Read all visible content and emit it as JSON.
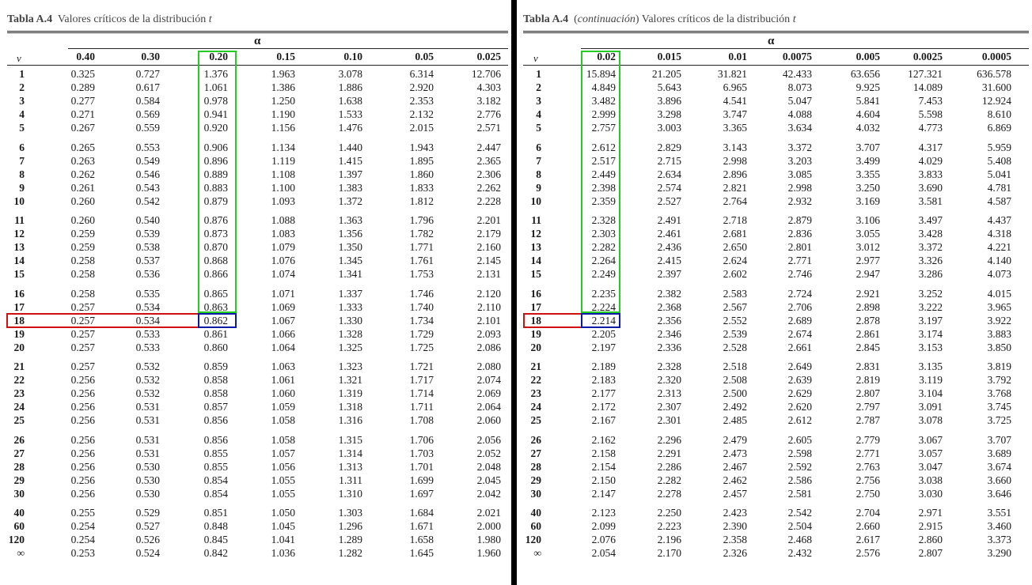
{
  "left": {
    "caption_bold": "Tabla A.4",
    "caption_text": "Valores críticos de la distribución",
    "caption_var": "t",
    "alpha_symbol": "α",
    "nu_symbol": "v",
    "columns": [
      "0.40",
      "0.30",
      "0.20",
      "0.15",
      "0.10",
      "0.05",
      "0.025"
    ],
    "rows": [
      {
        "nu": "1",
        "v": [
          "0.325",
          "0.727",
          "1.376",
          "1.963",
          "3.078",
          "6.314",
          "12.706"
        ]
      },
      {
        "nu": "2",
        "v": [
          "0.289",
          "0.617",
          "1.061",
          "1.386",
          "1.886",
          "2.920",
          "4.303"
        ]
      },
      {
        "nu": "3",
        "v": [
          "0.277",
          "0.584",
          "0.978",
          "1.250",
          "1.638",
          "2.353",
          "3.182"
        ]
      },
      {
        "nu": "4",
        "v": [
          "0.271",
          "0.569",
          "0.941",
          "1.190",
          "1.533",
          "2.132",
          "2.776"
        ]
      },
      {
        "nu": "5",
        "v": [
          "0.267",
          "0.559",
          "0.920",
          "1.156",
          "1.476",
          "2.015",
          "2.571"
        ]
      },
      {
        "nu": "6",
        "v": [
          "0.265",
          "0.553",
          "0.906",
          "1.134",
          "1.440",
          "1.943",
          "2.447"
        ]
      },
      {
        "nu": "7",
        "v": [
          "0.263",
          "0.549",
          "0.896",
          "1.119",
          "1.415",
          "1.895",
          "2.365"
        ]
      },
      {
        "nu": "8",
        "v": [
          "0.262",
          "0.546",
          "0.889",
          "1.108",
          "1.397",
          "1.860",
          "2.306"
        ]
      },
      {
        "nu": "9",
        "v": [
          "0.261",
          "0.543",
          "0.883",
          "1.100",
          "1.383",
          "1.833",
          "2.262"
        ]
      },
      {
        "nu": "10",
        "v": [
          "0.260",
          "0.542",
          "0.879",
          "1.093",
          "1.372",
          "1.812",
          "2.228"
        ]
      },
      {
        "nu": "11",
        "v": [
          "0.260",
          "0.540",
          "0.876",
          "1.088",
          "1.363",
          "1.796",
          "2.201"
        ]
      },
      {
        "nu": "12",
        "v": [
          "0.259",
          "0.539",
          "0.873",
          "1.083",
          "1.356",
          "1.782",
          "2.179"
        ]
      },
      {
        "nu": "13",
        "v": [
          "0.259",
          "0.538",
          "0.870",
          "1.079",
          "1.350",
          "1.771",
          "2.160"
        ]
      },
      {
        "nu": "14",
        "v": [
          "0.258",
          "0.537",
          "0.868",
          "1.076",
          "1.345",
          "1.761",
          "2.145"
        ]
      },
      {
        "nu": "15",
        "v": [
          "0.258",
          "0.536",
          "0.866",
          "1.074",
          "1.341",
          "1.753",
          "2.131"
        ]
      },
      {
        "nu": "16",
        "v": [
          "0.258",
          "0.535",
          "0.865",
          "1.071",
          "1.337",
          "1.746",
          "2.120"
        ]
      },
      {
        "nu": "17",
        "v": [
          "0.257",
          "0.534",
          "0.863",
          "1.069",
          "1.333",
          "1.740",
          "2.110"
        ]
      },
      {
        "nu": "18",
        "v": [
          "0.257",
          "0.534",
          "0.862",
          "1.067",
          "1.330",
          "1.734",
          "2.101"
        ]
      },
      {
        "nu": "19",
        "v": [
          "0.257",
          "0.533",
          "0.861",
          "1.066",
          "1.328",
          "1.729",
          "2.093"
        ]
      },
      {
        "nu": "20",
        "v": [
          "0.257",
          "0.533",
          "0.860",
          "1.064",
          "1.325",
          "1.725",
          "2.086"
        ]
      },
      {
        "nu": "21",
        "v": [
          "0.257",
          "0.532",
          "0.859",
          "1.063",
          "1.323",
          "1.721",
          "2.080"
        ]
      },
      {
        "nu": "22",
        "v": [
          "0.256",
          "0.532",
          "0.858",
          "1.061",
          "1.321",
          "1.717",
          "2.074"
        ]
      },
      {
        "nu": "23",
        "v": [
          "0.256",
          "0.532",
          "0.858",
          "1.060",
          "1.319",
          "1.714",
          "2.069"
        ]
      },
      {
        "nu": "24",
        "v": [
          "0.256",
          "0.531",
          "0.857",
          "1.059",
          "1.318",
          "1.711",
          "2.064"
        ]
      },
      {
        "nu": "25",
        "v": [
          "0.256",
          "0.531",
          "0.856",
          "1.058",
          "1.316",
          "1.708",
          "2.060"
        ]
      },
      {
        "nu": "26",
        "v": [
          "0.256",
          "0.531",
          "0.856",
          "1.058",
          "1.315",
          "1.706",
          "2.056"
        ]
      },
      {
        "nu": "27",
        "v": [
          "0.256",
          "0.531",
          "0.855",
          "1.057",
          "1.314",
          "1.703",
          "2.052"
        ]
      },
      {
        "nu": "28",
        "v": [
          "0.256",
          "0.530",
          "0.855",
          "1.056",
          "1.313",
          "1.701",
          "2.048"
        ]
      },
      {
        "nu": "29",
        "v": [
          "0.256",
          "0.530",
          "0.854",
          "1.055",
          "1.311",
          "1.699",
          "2.045"
        ]
      },
      {
        "nu": "30",
        "v": [
          "0.256",
          "0.530",
          "0.854",
          "1.055",
          "1.310",
          "1.697",
          "2.042"
        ]
      },
      {
        "nu": "40",
        "v": [
          "0.255",
          "0.529",
          "0.851",
          "1.050",
          "1.303",
          "1.684",
          "2.021"
        ]
      },
      {
        "nu": "60",
        "v": [
          "0.254",
          "0.527",
          "0.848",
          "1.045",
          "1.296",
          "1.671",
          "2.000"
        ]
      },
      {
        "nu": "120",
        "v": [
          "0.254",
          "0.526",
          "0.845",
          "1.041",
          "1.289",
          "1.658",
          "1.980"
        ]
      },
      {
        "nu": "∞",
        "v": [
          "0.253",
          "0.524",
          "0.842",
          "1.036",
          "1.282",
          "1.645",
          "1.960"
        ]
      }
    ]
  },
  "right": {
    "caption_bold": "Tabla A.4",
    "caption_paren_open": "(",
    "caption_cont": "continuación",
    "caption_paren_close": ")",
    "caption_text": "Valores críticos de la distribución",
    "caption_var": "t",
    "alpha_symbol": "α",
    "nu_symbol": "v",
    "columns": [
      "0.02",
      "0.015",
      "0.01",
      "0.0075",
      "0.005",
      "0.0025",
      "0.0005"
    ],
    "rows": [
      {
        "nu": "1",
        "v": [
          "15.894",
          "21.205",
          "31.821",
          "42.433",
          "63.656",
          "127.321",
          "636.578"
        ]
      },
      {
        "nu": "2",
        "v": [
          "4.849",
          "5.643",
          "6.965",
          "8.073",
          "9.925",
          "14.089",
          "31.600"
        ]
      },
      {
        "nu": "3",
        "v": [
          "3.482",
          "3.896",
          "4.541",
          "5.047",
          "5.841",
          "7.453",
          "12.924"
        ]
      },
      {
        "nu": "4",
        "v": [
          "2.999",
          "3.298",
          "3.747",
          "4.088",
          "4.604",
          "5.598",
          "8.610"
        ]
      },
      {
        "nu": "5",
        "v": [
          "2.757",
          "3.003",
          "3.365",
          "3.634",
          "4.032",
          "4.773",
          "6.869"
        ]
      },
      {
        "nu": "6",
        "v": [
          "2.612",
          "2.829",
          "3.143",
          "3.372",
          "3.707",
          "4.317",
          "5.959"
        ]
      },
      {
        "nu": "7",
        "v": [
          "2.517",
          "2.715",
          "2.998",
          "3.203",
          "3.499",
          "4.029",
          "5.408"
        ]
      },
      {
        "nu": "8",
        "v": [
          "2.449",
          "2.634",
          "2.896",
          "3.085",
          "3.355",
          "3.833",
          "5.041"
        ]
      },
      {
        "nu": "9",
        "v": [
          "2.398",
          "2.574",
          "2.821",
          "2.998",
          "3.250",
          "3.690",
          "4.781"
        ]
      },
      {
        "nu": "10",
        "v": [
          "2.359",
          "2.527",
          "2.764",
          "2.932",
          "3.169",
          "3.581",
          "4.587"
        ]
      },
      {
        "nu": "11",
        "v": [
          "2.328",
          "2.491",
          "2.718",
          "2.879",
          "3.106",
          "3.497",
          "4.437"
        ]
      },
      {
        "nu": "12",
        "v": [
          "2.303",
          "2.461",
          "2.681",
          "2.836",
          "3.055",
          "3.428",
          "4.318"
        ]
      },
      {
        "nu": "13",
        "v": [
          "2.282",
          "2.436",
          "2.650",
          "2.801",
          "3.012",
          "3.372",
          "4.221"
        ]
      },
      {
        "nu": "14",
        "v": [
          "2.264",
          "2.415",
          "2.624",
          "2.771",
          "2.977",
          "3.326",
          "4.140"
        ]
      },
      {
        "nu": "15",
        "v": [
          "2.249",
          "2.397",
          "2.602",
          "2.746",
          "2.947",
          "3.286",
          "4.073"
        ]
      },
      {
        "nu": "16",
        "v": [
          "2.235",
          "2.382",
          "2.583",
          "2.724",
          "2.921",
          "3.252",
          "4.015"
        ]
      },
      {
        "nu": "17",
        "v": [
          "2.224",
          "2.368",
          "2.567",
          "2.706",
          "2.898",
          "3.222",
          "3.965"
        ]
      },
      {
        "nu": "18",
        "v": [
          "2.214",
          "2.356",
          "2.552",
          "2.689",
          "2.878",
          "3.197",
          "3.922"
        ]
      },
      {
        "nu": "19",
        "v": [
          "2.205",
          "2.346",
          "2.539",
          "2.674",
          "2.861",
          "3.174",
          "3.883"
        ]
      },
      {
        "nu": "20",
        "v": [
          "2.197",
          "2.336",
          "2.528",
          "2.661",
          "2.845",
          "3.153",
          "3.850"
        ]
      },
      {
        "nu": "21",
        "v": [
          "2.189",
          "2.328",
          "2.518",
          "2.649",
          "2.831",
          "3.135",
          "3.819"
        ]
      },
      {
        "nu": "22",
        "v": [
          "2.183",
          "2.320",
          "2.508",
          "2.639",
          "2.819",
          "3.119",
          "3.792"
        ]
      },
      {
        "nu": "23",
        "v": [
          "2.177",
          "2.313",
          "2.500",
          "2.629",
          "2.807",
          "3.104",
          "3.768"
        ]
      },
      {
        "nu": "24",
        "v": [
          "2.172",
          "2.307",
          "2.492",
          "2.620",
          "2.797",
          "3.091",
          "3.745"
        ]
      },
      {
        "nu": "25",
        "v": [
          "2.167",
          "2.301",
          "2.485",
          "2.612",
          "2.787",
          "3.078",
          "3.725"
        ]
      },
      {
        "nu": "26",
        "v": [
          "2.162",
          "2.296",
          "2.479",
          "2.605",
          "2.779",
          "3.067",
          "3.707"
        ]
      },
      {
        "nu": "27",
        "v": [
          "2.158",
          "2.291",
          "2.473",
          "2.598",
          "2.771",
          "3.057",
          "3.689"
        ]
      },
      {
        "nu": "28",
        "v": [
          "2.154",
          "2.286",
          "2.467",
          "2.592",
          "2.763",
          "3.047",
          "3.674"
        ]
      },
      {
        "nu": "29",
        "v": [
          "2.150",
          "2.282",
          "2.462",
          "2.586",
          "2.756",
          "3.038",
          "3.660"
        ]
      },
      {
        "nu": "30",
        "v": [
          "2.147",
          "2.278",
          "2.457",
          "2.581",
          "2.750",
          "3.030",
          "3.646"
        ]
      },
      {
        "nu": "40",
        "v": [
          "2.123",
          "2.250",
          "2.423",
          "2.542",
          "2.704",
          "2.971",
          "3.551"
        ]
      },
      {
        "nu": "60",
        "v": [
          "2.099",
          "2.223",
          "2.390",
          "2.504",
          "2.660",
          "2.915",
          "3.460"
        ]
      },
      {
        "nu": "120",
        "v": [
          "2.076",
          "2.196",
          "2.358",
          "2.468",
          "2.617",
          "2.860",
          "3.373"
        ]
      },
      {
        "nu": "∞",
        "v": [
          "2.054",
          "2.170",
          "2.326",
          "2.432",
          "2.576",
          "2.807",
          "3.290"
        ]
      }
    ]
  },
  "highlight_colors": {
    "column": "#22cc22",
    "row": "#d01010",
    "cell": "#0a1aa8"
  }
}
